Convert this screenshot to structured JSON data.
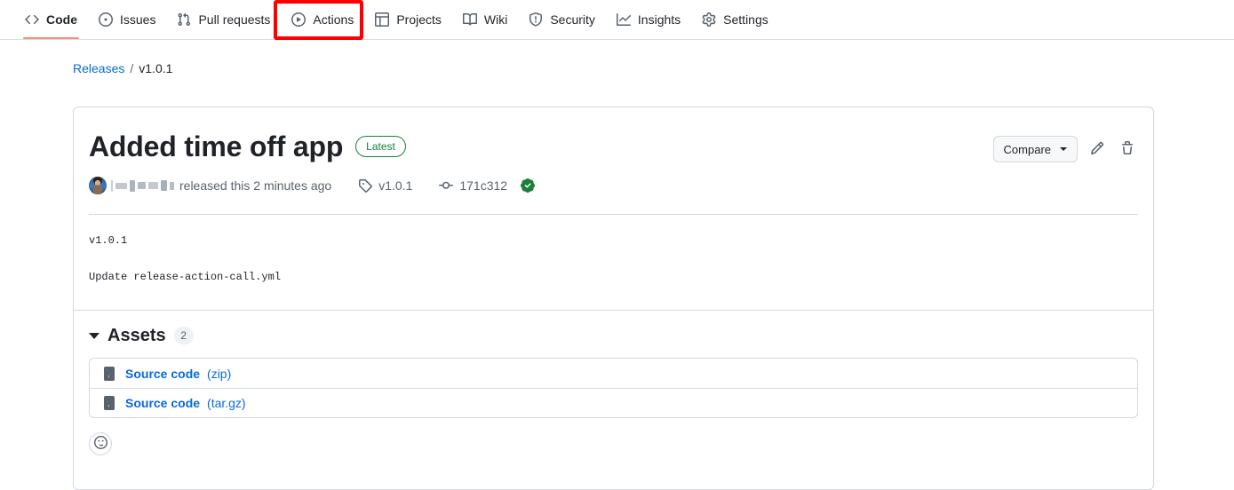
{
  "nav": {
    "items": [
      {
        "label": "Code",
        "icon": "code-icon",
        "active": true
      },
      {
        "label": "Issues",
        "icon": "issue-icon",
        "active": false
      },
      {
        "label": "Pull requests",
        "icon": "git-pull-request-icon",
        "active": false
      },
      {
        "label": "Actions",
        "icon": "play-icon",
        "active": false
      },
      {
        "label": "Projects",
        "icon": "table-icon",
        "active": false
      },
      {
        "label": "Wiki",
        "icon": "book-icon",
        "active": false
      },
      {
        "label": "Security",
        "icon": "shield-icon",
        "active": false
      },
      {
        "label": "Insights",
        "icon": "graph-icon",
        "active": false
      },
      {
        "label": "Settings",
        "icon": "gear-icon",
        "active": false
      }
    ],
    "highlight": {
      "target": "Actions",
      "color": "#ff0000"
    }
  },
  "breadcrumb": {
    "root": "Releases",
    "separator": "/",
    "current": "v1.0.1"
  },
  "release": {
    "title": "Added time off app",
    "badge": "Latest",
    "author_redacted": true,
    "released_text": "released this 2 minutes ago",
    "tag": "v1.0.1",
    "tag_icon": "tag-icon",
    "commit": "171c312",
    "commit_icon": "git-commit-icon",
    "verified_icon": "verified-check-icon",
    "body_lines": [
      "v1.0.1",
      "Update release-action-call.yml"
    ]
  },
  "toolbar": {
    "compare_label": "Compare",
    "edit_icon": "pencil-icon",
    "delete_icon": "trash-icon"
  },
  "assets": {
    "title": "Assets",
    "count": "2",
    "items": [
      {
        "name": "Source code",
        "ext": "(zip)",
        "icon": "file-zip-icon"
      },
      {
        "name": "Source code",
        "ext": "(tar.gz)",
        "icon": "file-zip-icon"
      }
    ]
  },
  "reaction": {
    "icon": "smiley-icon"
  },
  "colors": {
    "accent_link": "#0969da",
    "active_underline": "#fd8c73",
    "success_green": "#1a7f37",
    "border": "#d1d9e0",
    "annotation_red": "#ff0000"
  }
}
